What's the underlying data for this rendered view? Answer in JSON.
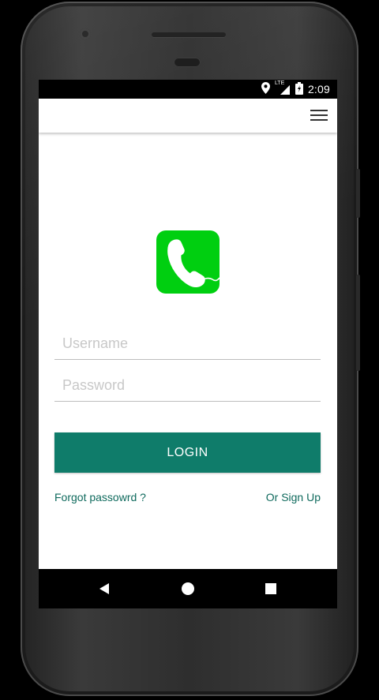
{
  "status_bar": {
    "time": "2:09",
    "network_label": "LTE",
    "icons": [
      "location-icon",
      "lte-signal-icon",
      "battery-icon"
    ]
  },
  "app_bar": {
    "menu_icon": "hamburger-menu-icon"
  },
  "logo": {
    "icon": "phone-handset-icon",
    "background_color": "#00cf10"
  },
  "login_form": {
    "username_placeholder": "Username",
    "password_placeholder": "Password",
    "login_button_label": "LOGIN",
    "forgot_password_label": "Forgot passowrd ?",
    "sign_up_label": "Or Sign Up"
  },
  "nav_bar": {
    "buttons": [
      "back-icon",
      "home-icon",
      "recents-icon"
    ]
  },
  "colors": {
    "accent": "#0f7c6a",
    "link": "#0f6a5d",
    "logo_green": "#00cf10"
  }
}
